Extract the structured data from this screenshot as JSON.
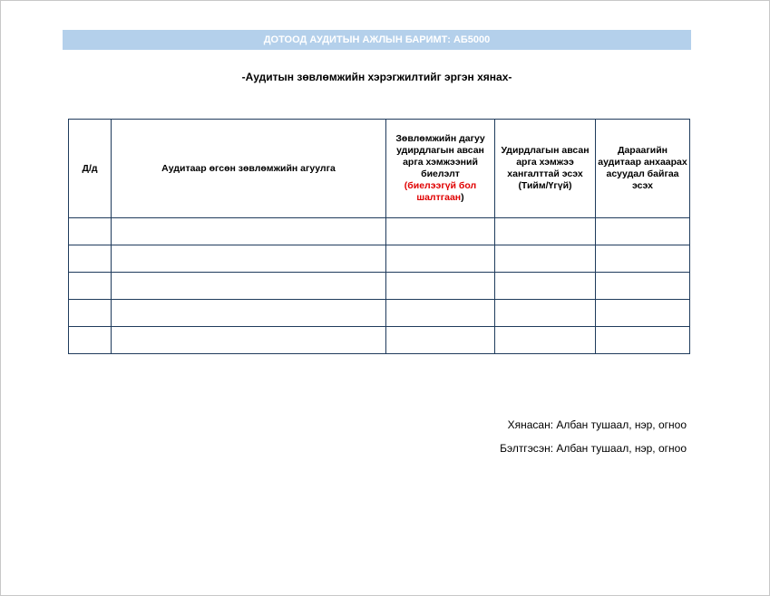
{
  "header": {
    "title": "ДОТООД АУДИТЫН АЖЛЫН БАРИМТ: АБ5000"
  },
  "document": {
    "title": "-Аудитын зөвлөмжийн хэрэгжилтийг эргэн хянах-"
  },
  "table": {
    "columns": {
      "number": "Д/д",
      "content": "Аудитаар өгсөн зөвлөмжийн агуулга",
      "implementation_main": "Зөвлөмжийн дагуу удирдлагын авсан арга хэмжээний биелэлт",
      "implementation_note": "(биелээгүй бол шалтгаан",
      "implementation_close": ")",
      "adequacy": "Удирдлагын авсан арга хэмжээ хангалттай эсэх (Тийм/Үгүй)",
      "next_audit": "Дараагийн аудитаар анхаарах асуудал байгаа эсэх"
    },
    "rows": [
      [
        "",
        "",
        "",
        "",
        ""
      ],
      [
        "",
        "",
        "",
        "",
        ""
      ],
      [
        "",
        "",
        "",
        "",
        ""
      ],
      [
        "",
        "",
        "",
        "",
        ""
      ],
      [
        "",
        "",
        "",
        "",
        ""
      ]
    ]
  },
  "signatures": {
    "reviewed": "Хянасан: Албан тушаал, нэр, огноо",
    "prepared": "Бэлтгэсэн: Албан тушаал, нэр, огноо"
  },
  "colors": {
    "header_bg": "#b4d0eb",
    "table_border": "#1f3b5c",
    "accent_red": "#e00000"
  }
}
